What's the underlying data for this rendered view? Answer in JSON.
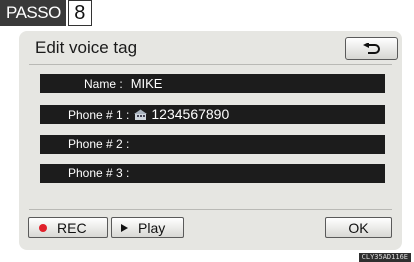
{
  "page_tag": {
    "model": "PASSO",
    "page_number": "8"
  },
  "header": {
    "title": "Edit voice tag",
    "back_icon": "return-arrow-icon"
  },
  "entries": [
    {
      "label": "Name :",
      "value": "MIKE"
    },
    {
      "label": "Phone # 1 :",
      "icon": "phone-type-icon",
      "value": "1234567890"
    },
    {
      "label": "Phone # 2 :",
      "value": ""
    },
    {
      "label": "Phone # 3 :",
      "value": ""
    }
  ],
  "footer": {
    "rec_label": "REC",
    "play_label": "Play",
    "ok_label": "OK"
  },
  "image_code": "CLY35AD116E",
  "colors": {
    "row_background": "#1c1c1c",
    "record_dot": "#e0202a",
    "screen_background": "#e6e6e2"
  }
}
